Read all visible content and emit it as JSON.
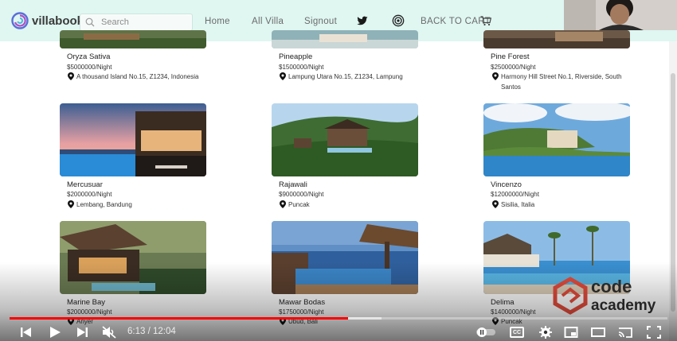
{
  "navbar": {
    "brand": "villabooki",
    "search_placeholder": "Search",
    "links": [
      "Home",
      "All Villa",
      "Signout"
    ],
    "cart_label": "BACK TO CART"
  },
  "villas": [
    {
      "name": "Oryza Sativa",
      "price": "$5000000/Night",
      "address": "A thousand Island No.15, Z1234, Indonesia"
    },
    {
      "name": "Pineapple",
      "price": "$1500000/Night",
      "address": "Lampung Utara No.15, Z1234, Lampung"
    },
    {
      "name": "Pine Forest",
      "price": "$2500000/Night",
      "address": "Harmony Hill Street No.1, Riverside, South Santos"
    },
    {
      "name": "Mercusuar",
      "price": "$2000000/Night",
      "address": "Lembang, Bandung"
    },
    {
      "name": "Rajawali",
      "price": "$9000000/Night",
      "address": "Puncak"
    },
    {
      "name": "Vincenzo",
      "price": "$12000000/Night",
      "address": "Sisilia, Italia"
    },
    {
      "name": "Marine Bay",
      "price": "$2000000/Night",
      "address": "Anyer"
    },
    {
      "name": "Mawar Bodas",
      "price": "$1750000/Night",
      "address": "Ubud, Bali"
    },
    {
      "name": "Delima",
      "price": "$1400000/Night",
      "address": "Puncak"
    }
  ],
  "watermark": {
    "line1": "code",
    "line2": "academy"
  },
  "player": {
    "time": "6:13 / 12:04",
    "played_fraction": 0.515,
    "loaded_fraction": 0.565,
    "cc_label": "CC"
  }
}
